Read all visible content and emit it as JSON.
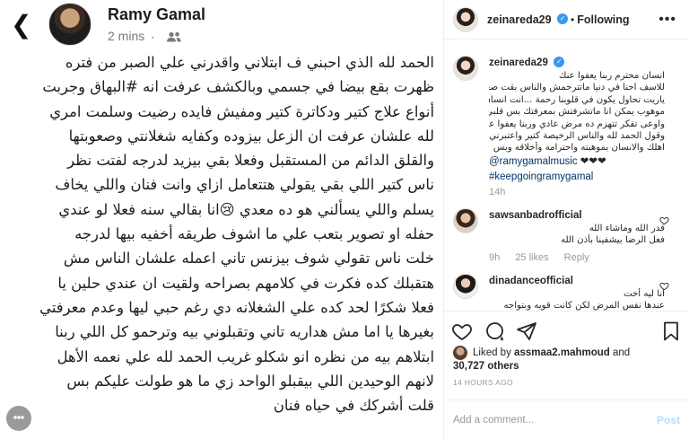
{
  "facebook_post": {
    "author": "Ramy Gamal",
    "time": "2 mins",
    "lines": [
      "الحمد لله الذي احبني ف ابتلاني واقدرني علي الصبر من فتره",
      "ظهرت بقع بيضا في جسمي وبالكشف عرفت انه #البهاق وجربت",
      "أنواع علاج كتير ودكاترة كتير ومفيش فايده رضيت وسلمت امري",
      "لله علشان عرفت ان الزعل بيزوده وكفايه شغلانتي وصعوبتها",
      "والقلق الدائم من المستقبل وفعلا بقي بيزيد لدرجه لفتت نظر",
      "ناس كتير اللي بقي يقولي هتتعامل ازاي وانت فنان واللي يخاف",
      "يسلم واللي يسألني هو ده معدي 😢انا بقالي سنه فعلا لو عندي",
      "حفله او تصوير بتعب علي ما اشوف طريقه أخفيه بيها لدرجه",
      "خلت ناس تقولي شوف بيزنس تاني اعمله علشان الناس مش",
      "هتقبلك كده فكرت في كلامهم بصراحه ولقيت ان  عندي حلين يا",
      "فعلا شكرًا لحد كده علي الشغلانه دي رغم حبي ليها وعدم معرفتي",
      "بغيرها يا اما مش هداريه تاني وتقبلوني بيه  وترحمو كل اللي ربنا",
      "ابتلاهم  بيه من نظره انو شكلو غريب  الحمد لله علي  نعمه الأهل",
      "لانهم الوحيدين اللي بيقبلو الواحد زي ما هو طولت عليكم بس",
      "قلت أشركك   في حياه فنان"
    ]
  },
  "instagram": {
    "header": {
      "username": "zeinareda29",
      "follow_label": "Following",
      "separator": "•"
    },
    "caption": {
      "username": "zeinareda29",
      "lines": [
        "انسان محترم ربنا يعفوا عنك",
        "للاسف احنا في دنيا ماتترحمش والناس بقت صعبة...",
        "ياريت تحاول يكون في قلوبنا رحمة ...انت انسان",
        "موهوب يمكن انا ماتشرفتش بمعرفتك بس قلبي معاك",
        "واوعى تفكر تتهزم ده مرض عادي وربنا يعفوا عنك",
        "وقول الحمد لله والناس الرخيصة كتير واعتبرني من",
        "اهلك والانسان بموهبته واحترامه وأخلاقه وبس"
      ],
      "mention": "@ramygamalmusic",
      "emoji": "❤❤❤",
      "hashtag": "#keepgoingramygamal",
      "time": "14h"
    },
    "comments": [
      {
        "username": "sawsanbadrofficial",
        "lines": [
          "قدر الله وماشاء الله",
          "فعل الرضا بيشفينا بأذن الله"
        ],
        "time": "9h",
        "likes": "25 likes",
        "reply": "Reply"
      },
      {
        "username": "dinadanceofficial",
        "lines": [
          "انا ليه أخت",
          "عندها نفس المرض لكن كانت قويه وبتواجه"
        ],
        "time": "",
        "likes": "",
        "reply": ""
      }
    ],
    "likes": {
      "prefix": "Liked by",
      "first_user": "assmaa2.mahmoud",
      "connector": "and",
      "others": "30,727 others"
    },
    "timestamp": "14 HOURS AGO",
    "add_comment_placeholder": "Add a comment...",
    "post_label": "Post"
  }
}
